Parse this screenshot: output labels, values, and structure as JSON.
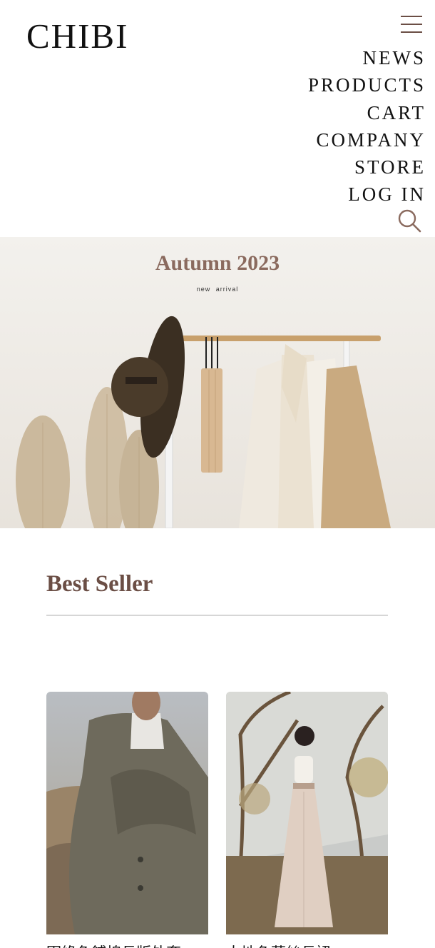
{
  "header": {
    "logo": "CHIBI",
    "menu_icon": "hamburger-menu-icon",
    "nav": [
      "NEWS",
      "PRODUCTS",
      "CART",
      "COMPANY",
      "STORE",
      "LOG IN"
    ],
    "search_icon": "search-icon"
  },
  "hero": {
    "title": "Autumn 2023",
    "subtitle": "new  arrival"
  },
  "best_seller": {
    "title": "Best Seller",
    "products": [
      {
        "name": "軍綠色鋪棉長版外套"
      },
      {
        "name": "大地色蕾絲長裙"
      }
    ]
  },
  "colors": {
    "accent": "#6b4e45",
    "hero_title": "#8a6a5e",
    "divider": "#d6d6d6"
  }
}
